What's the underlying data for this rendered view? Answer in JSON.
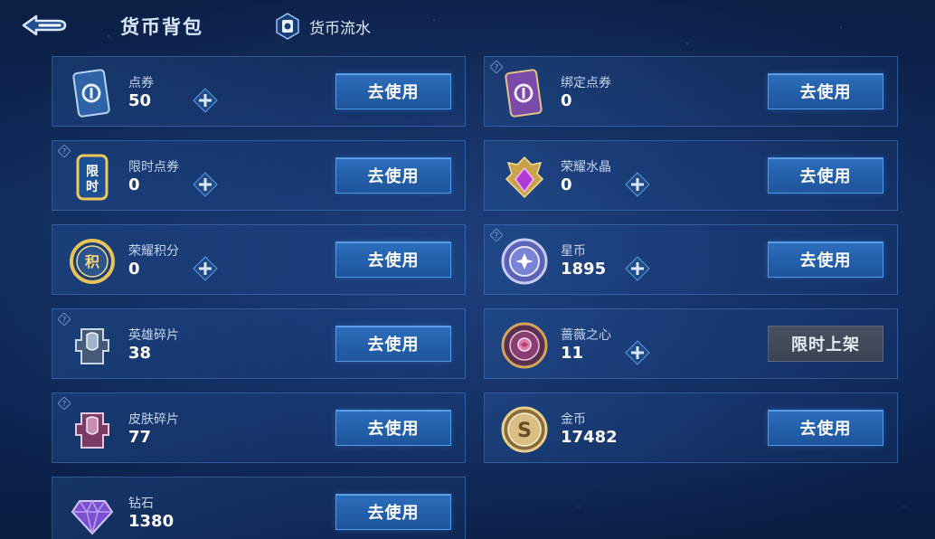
{
  "header": {
    "title": "货币背包",
    "ledger_label": "货币流水"
  },
  "cards": [
    {
      "name": "点券",
      "amount": "50",
      "button": "去使用"
    },
    {
      "name": "绑定点券",
      "amount": "0",
      "button": "去使用"
    },
    {
      "name": "限时点券",
      "amount": "0",
      "button": "去使用"
    },
    {
      "name": "荣耀水晶",
      "amount": "0",
      "button": "去使用"
    },
    {
      "name": "荣耀积分",
      "amount": "0",
      "button": "去使用"
    },
    {
      "name": "星币",
      "amount": "1895",
      "button": "去使用"
    },
    {
      "name": "英雄碎片",
      "amount": "38",
      "button": "去使用"
    },
    {
      "name": "蔷薇之心",
      "amount": "11",
      "button": "限时上架"
    },
    {
      "name": "皮肤碎片",
      "amount": "77",
      "button": "去使用"
    },
    {
      "name": "金币",
      "amount": "17482",
      "button": "去使用"
    },
    {
      "name": "钻石",
      "amount": "1380",
      "button": "去使用"
    }
  ],
  "icon_text": {
    "limited_voucher": "限时",
    "honor_points": "积",
    "gold": "S"
  },
  "colors": {
    "button_blue": "#2460ab",
    "button_disabled": "#3b4251",
    "card_border": "#5a96e6"
  }
}
